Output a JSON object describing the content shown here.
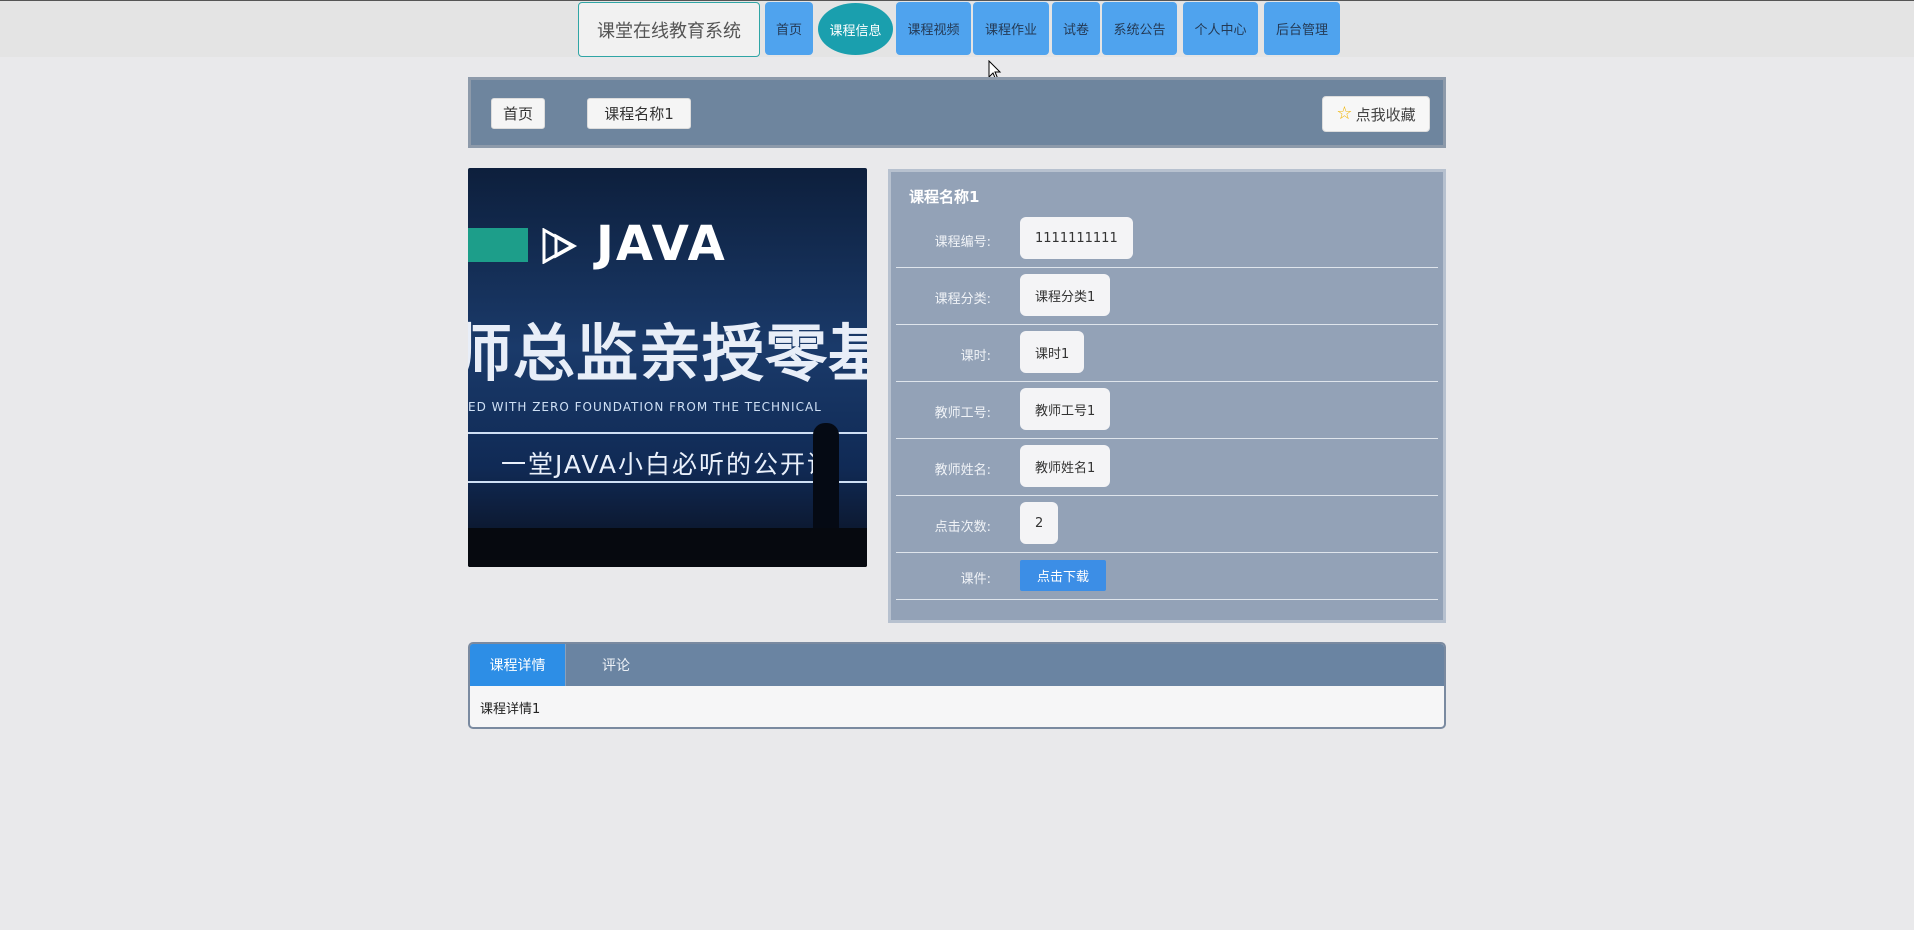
{
  "header": {
    "brand": "课堂在线教育系统",
    "nav": [
      {
        "label": "首页",
        "active": false
      },
      {
        "label": "课程信息",
        "active": true
      },
      {
        "label": "课程视频",
        "active": false
      },
      {
        "label": "课程作业",
        "active": false
      },
      {
        "label": "试卷",
        "active": false
      },
      {
        "label": "系统公告",
        "active": false
      },
      {
        "label": "个人中心",
        "active": false
      },
      {
        "label": "后台管理",
        "active": false
      }
    ]
  },
  "breadcrumb": {
    "home": "首页",
    "current": "课程名称1",
    "favorite": "点我收藏"
  },
  "course_image": {
    "text_java": "JAVA",
    "text_main": "师总监亲授零基础入",
    "text_english": "ED WITH ZERO FOUNDATION FROM THE TECHNICAL",
    "text_sub": "一堂JAVA小白必听的公开课"
  },
  "info": {
    "title": "课程名称1",
    "rows": [
      {
        "label": "课程编号:",
        "value": "1111111111"
      },
      {
        "label": "课程分类:",
        "value": "课程分类1"
      },
      {
        "label": "课时:",
        "value": "课时1"
      },
      {
        "label": "教师工号:",
        "value": "教师工号1"
      },
      {
        "label": "教师姓名:",
        "value": "教师姓名1"
      },
      {
        "label": "点击次数:",
        "value": "2"
      }
    ],
    "attachment_label": "课件:",
    "download": "点击下载"
  },
  "tabs": {
    "items": [
      "课程详情",
      "评论"
    ],
    "content": "课程详情1"
  },
  "colors": {
    "nav_bg": "#4fa3ee",
    "nav_active": "#1a9fae",
    "accent_blue": "#2d8ee6",
    "star": "#f0b400"
  }
}
